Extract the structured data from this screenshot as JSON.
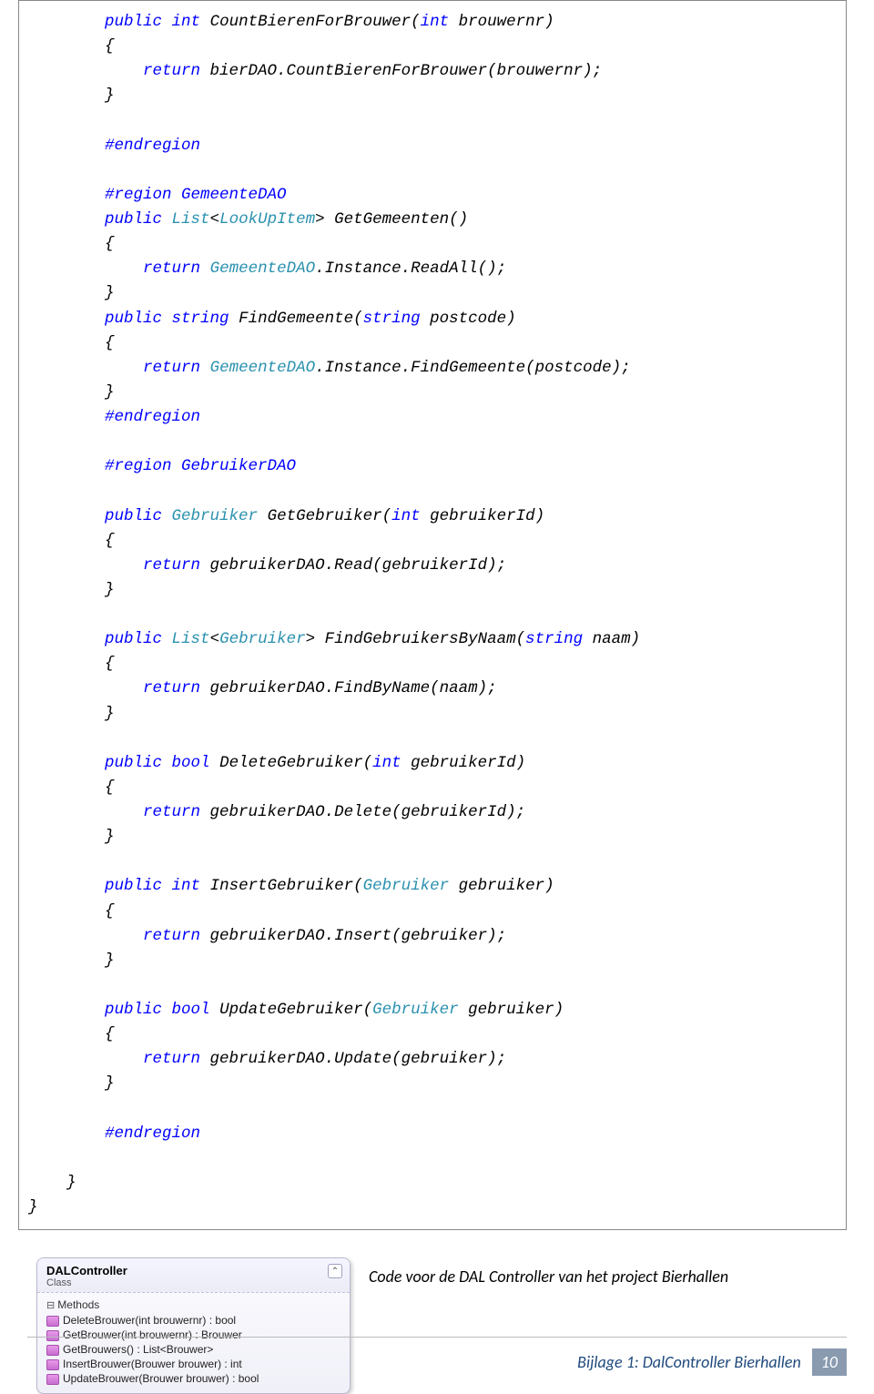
{
  "code": {
    "indent2": "        ",
    "indent3": "            ",
    "t": {
      "public": "public",
      "int": "int",
      "string": "string",
      "bool": "bool",
      "return": "return",
      "endregion": "#endregion",
      "region_gemeente": "#region GemeenteDAO",
      "region_gebruiker": "#region GebruikerDAO",
      "List": "List",
      "LookUpItem": "LookUpItem",
      "Gebruiker": "Gebruiker",
      "GemeenteDAO": "GemeenteDAO",
      "lbrace": "{",
      "rbrace": "}",
      "lt": "<",
      "gt": ">",
      "sp": " ",
      "close_class": "    }",
      "close_ns": "}"
    },
    "m1_sig_rest": " CountBierenForBrouwer(",
    "m1_param_rest": " brouwernr)",
    "m1_ret": " bierDAO.CountBierenForBrouwer(brouwernr);",
    "m2_sig_rest": " GetGemeenten()",
    "m2_ret_rest": ".Instance.ReadAll();",
    "m3_sig_a": " FindGemeente(",
    "m3_sig_b": " postcode)",
    "m3_ret_rest": ".Instance.FindGemeente(postcode);",
    "m4_sig_a": " GetGebruiker(",
    "m4_sig_b": " gebruikerId)",
    "m4_ret": " gebruikerDAO.Read(gebruikerId);",
    "m5_sig_a": " FindGebruikersByNaam(",
    "m5_sig_b": " naam)",
    "m5_ret": " gebruikerDAO.FindByName(naam);",
    "m6_sig_a": " DeleteGebruiker(",
    "m6_sig_b": " gebruikerId)",
    "m6_ret": " gebruikerDAO.Delete(gebruikerId);",
    "m7_sig_a": " InsertGebruiker(",
    "m7_sig_b": " gebruiker)",
    "m7_ret": " gebruikerDAO.Insert(gebruiker);",
    "m8_sig_a": " UpdateGebruiker(",
    "m8_sig_b": " gebruiker)",
    "m8_ret": " gebruikerDAO.Update(gebruiker);"
  },
  "caption": "Code voor de DAL Controller van het project Bierhallen",
  "diagram": {
    "class_name": "DALController",
    "stereotype": "Class",
    "section": "Methods",
    "collapse_glyph": "⌃",
    "methods": [
      "DeleteBrouwer(int brouwernr) : bool",
      "GetBrouwer(int brouwernr) : Brouwer",
      "GetBrouwers() : List<Brouwer>",
      "InsertBrouwer(Brouwer brouwer) : int",
      "UpdateBrouwer(Brouwer brouwer) : bool"
    ]
  },
  "footer": {
    "text": "Bijlage 1: DalController Bierhallen",
    "page": "10"
  }
}
